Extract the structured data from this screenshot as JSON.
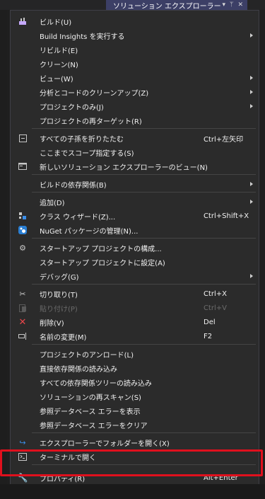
{
  "titlebar": {
    "title": "ソリューション エクスプローラー"
  },
  "menu": {
    "items": [
      {
        "label": "ビルド(U)",
        "icon": "build-icon"
      },
      {
        "label": "Build Insights を実行する",
        "submenu": true
      },
      {
        "label": "リビルド(E)"
      },
      {
        "label": "クリーン(N)"
      },
      {
        "label": "ビュー(W)",
        "submenu": true
      },
      {
        "label": "分析とコードのクリーンアップ(Z)",
        "submenu": true
      },
      {
        "label": "プロジェクトのみ(J)",
        "submenu": true
      },
      {
        "label": "プロジェクトの再ターゲット(R)"
      },
      {
        "label": "すべての子孫を折りたたむ",
        "shortcut": "Ctrl+左矢印",
        "icon": "collapse-icon"
      },
      {
        "label": "ここまでスコープ指定する(S)"
      },
      {
        "label": "新しいソリューション エクスプローラーのビュー(N)",
        "icon": "new-view-icon"
      },
      {
        "label": "ビルドの依存関係(B)",
        "submenu": true
      },
      {
        "label": "追加(D)",
        "submenu": true
      },
      {
        "label": "クラス ウィザード(Z)...",
        "shortcut": "Ctrl+Shift+X",
        "icon": "class-wizard-icon"
      },
      {
        "label": "NuGet パッケージの管理(N)...",
        "icon": "nuget-icon"
      },
      {
        "label": "スタートアップ プロジェクトの構成...",
        "icon": "gear-icon"
      },
      {
        "label": "スタートアップ プロジェクトに設定(A)"
      },
      {
        "label": "デバッグ(G)",
        "submenu": true
      },
      {
        "label": "切り取り(T)",
        "shortcut": "Ctrl+X",
        "icon": "cut-icon"
      },
      {
        "label": "貼り付け(P)",
        "shortcut": "Ctrl+V",
        "icon": "paste-icon",
        "disabled": true
      },
      {
        "label": "削除(V)",
        "shortcut": "Del",
        "icon": "delete-icon"
      },
      {
        "label": "名前の変更(M)",
        "shortcut": "F2",
        "icon": "rename-icon"
      },
      {
        "label": "プロジェクトのアンロード(L)"
      },
      {
        "label": "直接依存関係の読み込み"
      },
      {
        "label": "すべての依存関係ツリーの読み込み"
      },
      {
        "label": "ソリューションの再スキャン(S)"
      },
      {
        "label": "参照データベース エラーを表示"
      },
      {
        "label": "参照データベース エラーをクリア"
      },
      {
        "label": "エクスプローラーでフォルダーを開く(X)",
        "icon": "open-folder-icon"
      },
      {
        "label": "ターミナルで開く",
        "icon": "terminal-icon"
      },
      {
        "label": "プロパティ(R)",
        "shortcut": "Alt+Enter",
        "icon": "wrench-icon"
      }
    ]
  },
  "colors": {
    "highlight": "#e0101d",
    "menu_bg": "#2b2b2b",
    "accent": "#3c3f66"
  }
}
